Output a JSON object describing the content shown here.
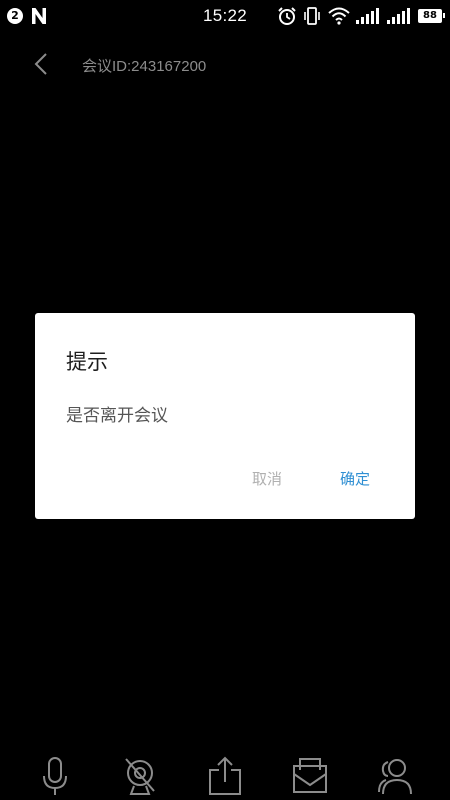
{
  "status_bar": {
    "notification_count": "2",
    "time": "15:22",
    "battery": "88",
    "icons": [
      "notification-badge-icon",
      "n-app-icon",
      "alarm-icon",
      "vibrate-icon",
      "wifi-icon",
      "signal-icon",
      "signal-icon",
      "battery-icon"
    ]
  },
  "header": {
    "meeting_id": "会议ID:243167200",
    "back_icon": "chevron-left-icon"
  },
  "dialog": {
    "title": "提示",
    "message": "是否离开会议",
    "cancel_label": "取消",
    "confirm_label": "确定",
    "confirm_color": "#2f8fd3",
    "cancel_color": "#b0b0b0"
  },
  "toolbar": {
    "icons": [
      "microphone-icon",
      "camera-off-icon",
      "share-icon",
      "message-icon",
      "participants-icon"
    ]
  }
}
